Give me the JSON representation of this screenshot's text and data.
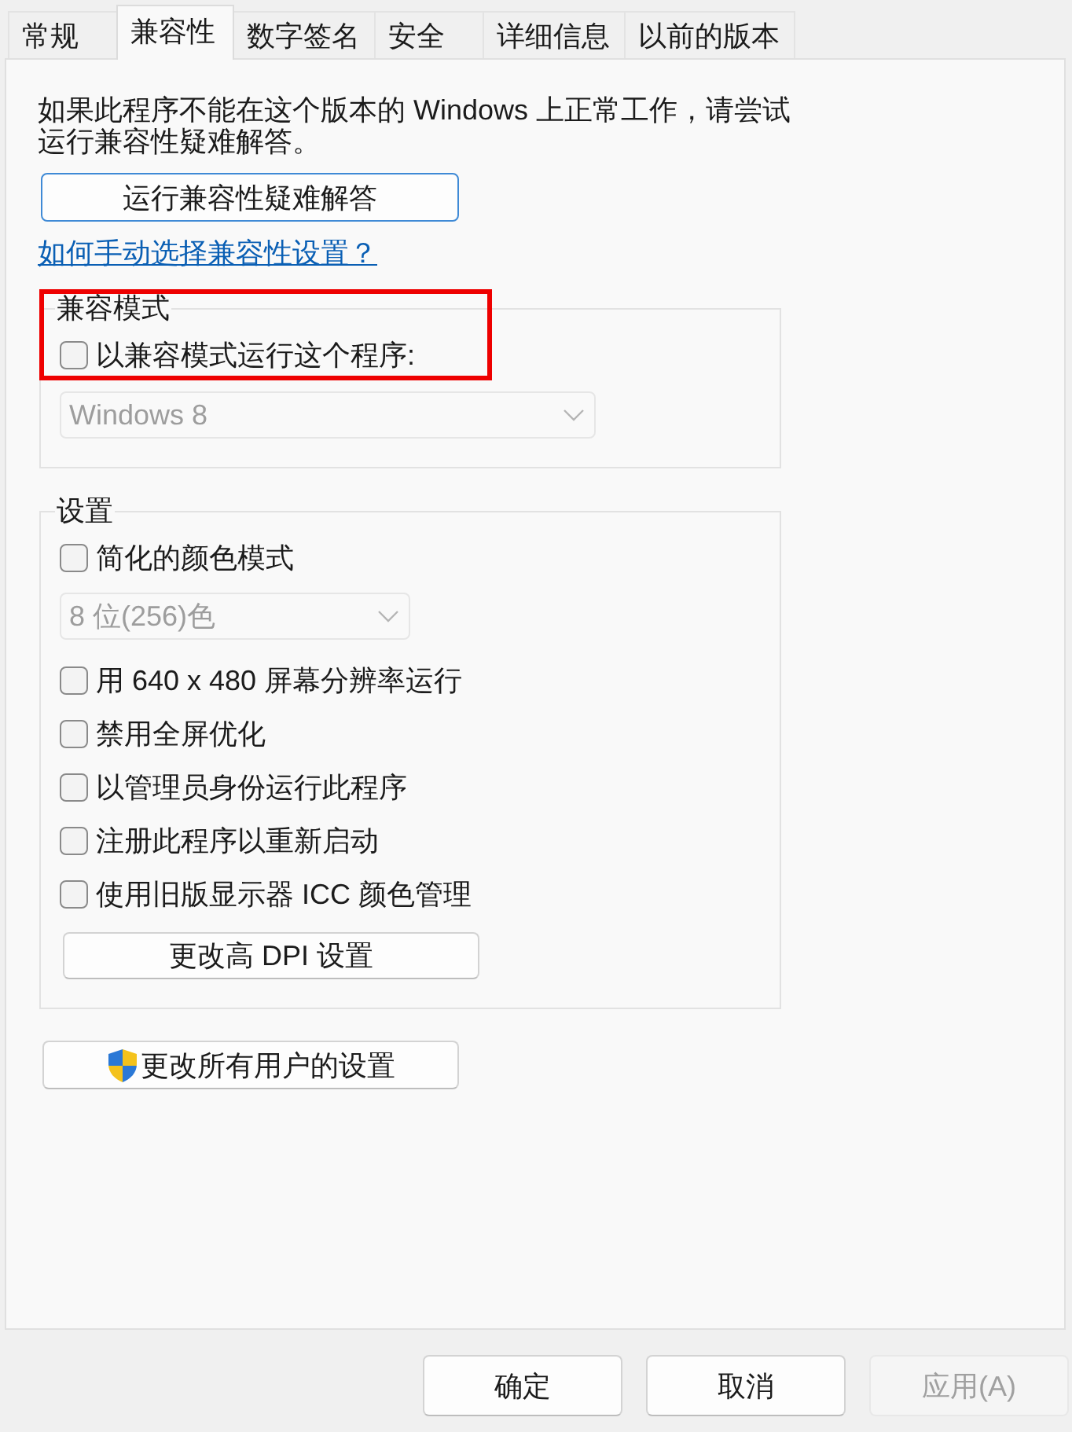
{
  "tabs": [
    {
      "label": "常规",
      "selected": false
    },
    {
      "label": "兼容性",
      "selected": true
    },
    {
      "label": "数字签名",
      "selected": false
    },
    {
      "label": "安全",
      "selected": false
    },
    {
      "label": "详细信息",
      "selected": false
    },
    {
      "label": "以前的版本",
      "selected": false
    }
  ],
  "intro_text": "如果此程序不能在这个版本的 Windows 上正常工作，请尝试运行兼容性疑难解答。",
  "troubleshooter_button": {
    "label": "运行兼容性疑难解答",
    "focused": true
  },
  "help_link": "如何手动选择兼容性设置？",
  "compatibility_mode": {
    "title": "兼容模式",
    "highlighted": true,
    "checkbox": {
      "label": "以兼容模式运行这个程序:",
      "checked": false
    },
    "dropdown": {
      "value": "Windows 8",
      "disabled": true
    }
  },
  "settings": {
    "title": "设置",
    "items": [
      {
        "kind": "checkbox",
        "label": "简化的颜色模式",
        "checked": false
      },
      {
        "kind": "dropdown",
        "value": "8 位(256)色",
        "disabled": true
      },
      {
        "kind": "checkbox",
        "label": "用 640 x 480 屏幕分辨率运行",
        "checked": false
      },
      {
        "kind": "checkbox",
        "label": "禁用全屏优化",
        "checked": false
      },
      {
        "kind": "checkbox",
        "label": "以管理员身份运行此程序",
        "checked": false
      },
      {
        "kind": "checkbox",
        "label": "注册此程序以重新启动",
        "checked": false
      },
      {
        "kind": "checkbox",
        "label": "使用旧版显示器 ICC 颜色管理",
        "checked": false
      },
      {
        "kind": "button",
        "label": "更改高 DPI 设置"
      }
    ]
  },
  "all_users_button": {
    "label": "更改所有用户的设置"
  },
  "dialog_buttons": [
    {
      "label": "确定",
      "disabled": false
    },
    {
      "label": "取消",
      "disabled": false
    },
    {
      "label": "应用(A)",
      "disabled": true
    }
  ]
}
